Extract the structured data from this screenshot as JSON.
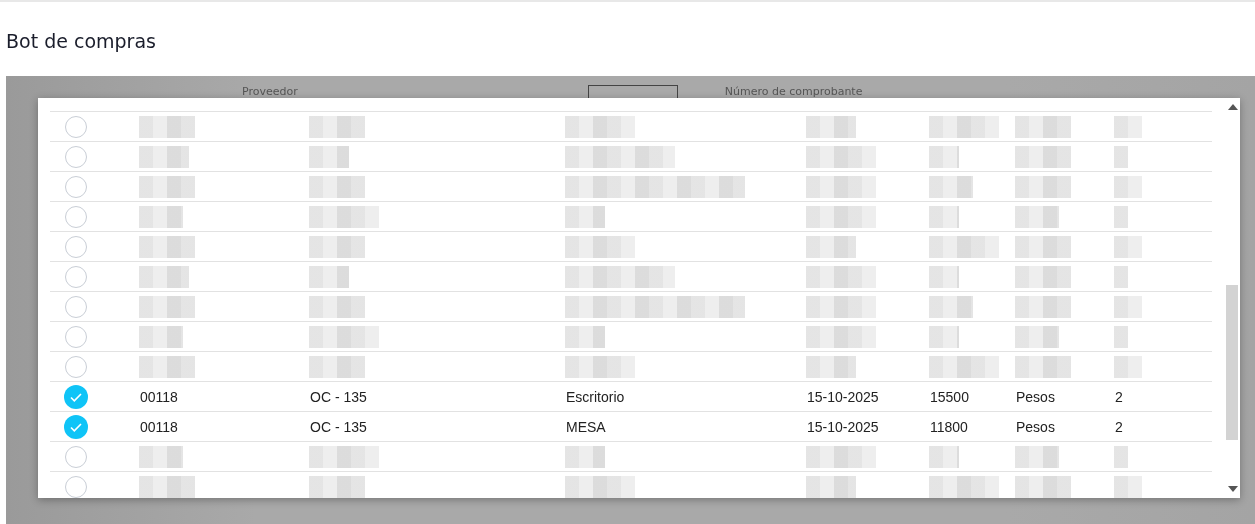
{
  "page": {
    "title": "Bot de compras"
  },
  "background_form": {
    "labels": [
      "Proveedor",
      "Número de comprobante"
    ]
  },
  "list": {
    "rows": [
      {
        "kind": "redacted",
        "selected": false
      },
      {
        "kind": "redacted",
        "selected": false
      },
      {
        "kind": "redacted",
        "selected": false
      },
      {
        "kind": "redacted",
        "selected": false
      },
      {
        "kind": "redacted",
        "selected": false
      },
      {
        "kind": "redacted",
        "selected": false
      },
      {
        "kind": "redacted",
        "selected": false
      },
      {
        "kind": "redacted",
        "selected": false
      },
      {
        "kind": "redacted",
        "selected": false
      },
      {
        "kind": "text",
        "selected": true,
        "cells": [
          "00118",
          "OC - 135",
          "Escritorio",
          "15-10-2025",
          "15500",
          "Pesos",
          "2"
        ]
      },
      {
        "kind": "text",
        "selected": true,
        "cells": [
          "00118",
          "OC - 135",
          "MESA",
          "15-10-2025",
          "11800",
          "Pesos",
          "2"
        ]
      },
      {
        "kind": "redacted",
        "selected": false
      },
      {
        "kind": "redacted",
        "selected": false
      }
    ]
  }
}
